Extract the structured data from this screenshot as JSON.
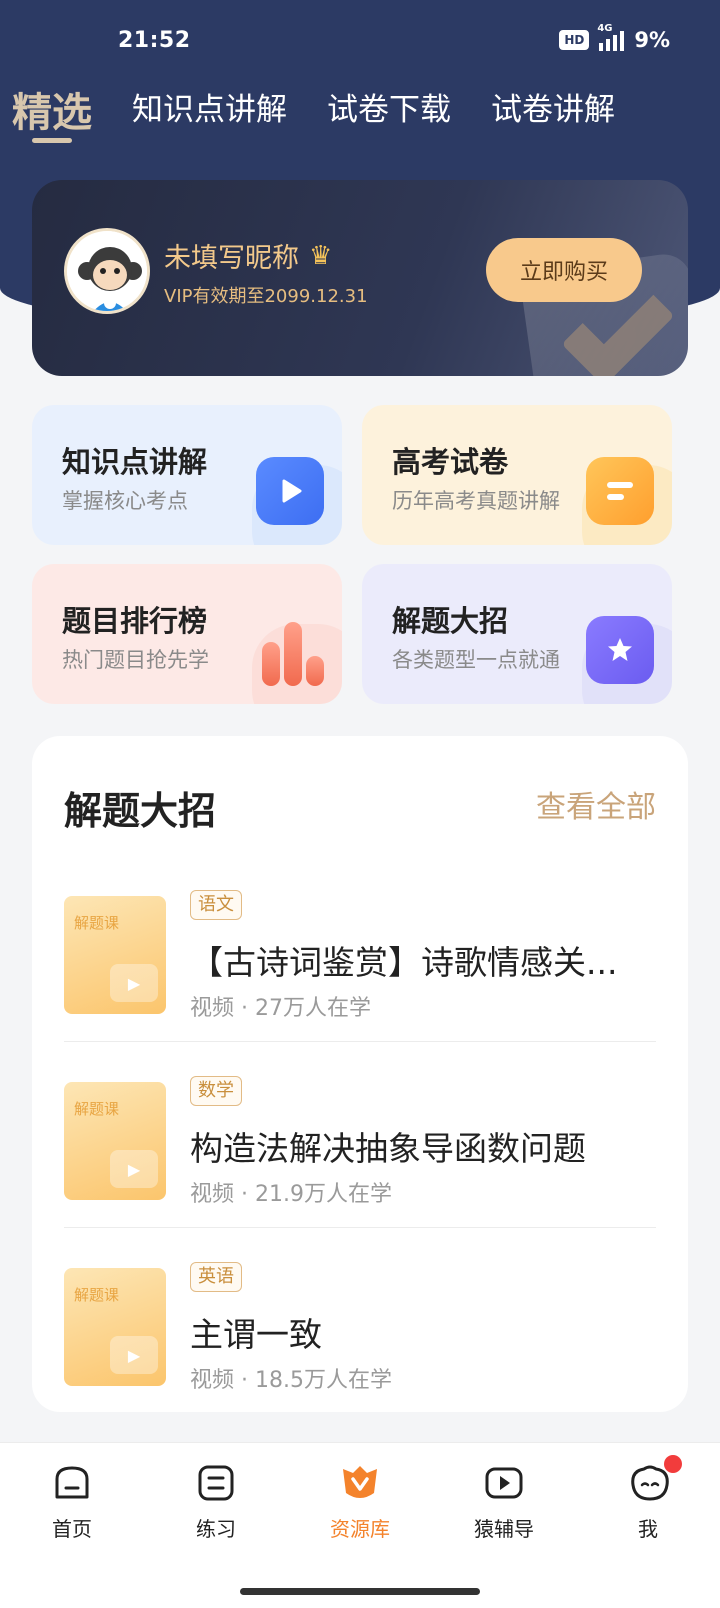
{
  "status_bar": {
    "time": "21:52",
    "hd": "HD",
    "network": "4G",
    "battery": "9%"
  },
  "top_tabs": [
    {
      "label": "精选",
      "active": true
    },
    {
      "label": "知识点讲解",
      "active": false
    },
    {
      "label": "试卷下载",
      "active": false
    },
    {
      "label": "试卷讲解",
      "active": false
    }
  ],
  "vip_card": {
    "nickname": "未填写昵称",
    "expiry": "VIP有效期至2099.12.31",
    "buy_label": "立即购买"
  },
  "features": [
    {
      "title": "知识点讲解",
      "subtitle": "掌握核心考点",
      "icon": "play-icon"
    },
    {
      "title": "高考试卷",
      "subtitle": "历年高考真题讲解",
      "icon": "document-icon"
    },
    {
      "title": "题目排行榜",
      "subtitle": "热门题目抢先学",
      "icon": "bar-chart-icon"
    },
    {
      "title": "解题大招",
      "subtitle": "各类题型一点就通",
      "icon": "star-bookmark-icon"
    }
  ],
  "section": {
    "title": "解题大招",
    "see_all": "查看全部",
    "thumb_label": "解题课",
    "items": [
      {
        "tag": "语文",
        "title": "【古诗词鉴赏】诗歌情感关...",
        "meta": "视频 · 27万人在学"
      },
      {
        "tag": "数学",
        "title": "构造法解决抽象导函数问题",
        "meta": "视频 · 21.9万人在学"
      },
      {
        "tag": "英语",
        "title": "主谓一致",
        "meta": "视频 · 18.5万人在学"
      }
    ]
  },
  "bottom_nav": [
    {
      "label": "首页",
      "icon": "home-icon",
      "active": false
    },
    {
      "label": "练习",
      "icon": "practice-icon",
      "active": false
    },
    {
      "label": "资源库",
      "icon": "library-icon",
      "active": true
    },
    {
      "label": "猿辅导",
      "icon": "video-play-icon",
      "active": false
    },
    {
      "label": "我",
      "icon": "profile-icon",
      "active": false,
      "badge": true
    }
  ],
  "colors": {
    "header_bg": "#2c3a64",
    "accent_gold": "#d8c7ad",
    "active_orange": "#f4832c",
    "buy_button": "#f8c98c"
  }
}
